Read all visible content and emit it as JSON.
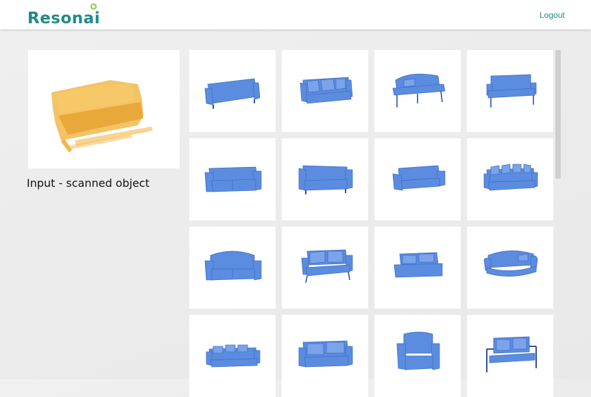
{
  "header": {
    "logo_text": "Resonai",
    "logout_label": "Logout"
  },
  "input": {
    "caption": "Input - scanned object"
  },
  "results": [
    {
      "icon": "sofa-result-icon"
    },
    {
      "icon": "sofa-result-icon"
    },
    {
      "icon": "settee-result-icon"
    },
    {
      "icon": "settee-result-icon"
    },
    {
      "icon": "sofa-result-icon"
    },
    {
      "icon": "sofa-result-icon"
    },
    {
      "icon": "sofa-result-icon"
    },
    {
      "icon": "sofa-result-icon"
    },
    {
      "icon": "sofa-result-icon"
    },
    {
      "icon": "sofa-result-icon"
    },
    {
      "icon": "sofa-result-icon"
    },
    {
      "icon": "sofa-result-icon"
    },
    {
      "icon": "sofa-result-icon"
    },
    {
      "icon": "sofa-result-icon"
    },
    {
      "icon": "armchair-result-icon"
    },
    {
      "icon": "settee-result-icon"
    }
  ],
  "colors": {
    "brand": "#1f8a88",
    "logo_accent": "#7fcf3f",
    "result_model": "#5b8ce0",
    "scan_model": "#f2b84b"
  }
}
